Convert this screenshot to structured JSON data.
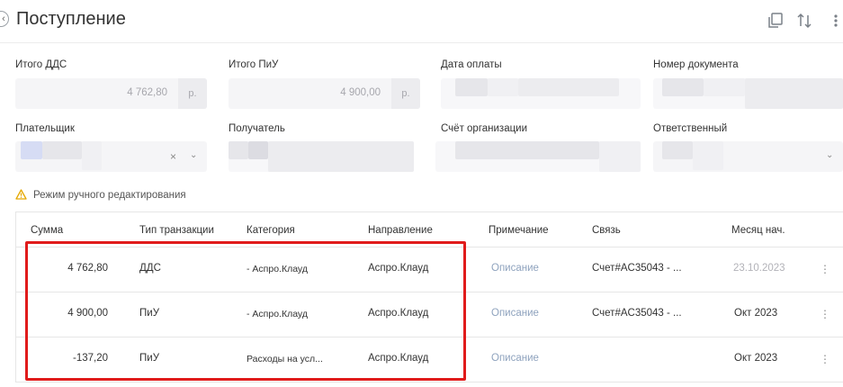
{
  "header": {
    "title": "Поступление",
    "back_icon": "chevron-left-icon",
    "copy_icon": "copy-icon",
    "sort_icon": "sort-arrows-icon",
    "more_icon": "more-vertical-icon"
  },
  "fields": {
    "total_dds": {
      "label": "Итого ДДС",
      "value": "4 762,80",
      "unit": "р."
    },
    "total_piu": {
      "label": "Итого ПиУ",
      "value": "4 900,00",
      "unit": "р."
    },
    "payment_date": {
      "label": "Дата оплаты"
    },
    "document_number": {
      "label": "Номер документа"
    },
    "payer": {
      "label": "Плательщик",
      "clear_icon": "clear-x-icon",
      "dropdown_icon": "chevron-down-icon"
    },
    "recipient": {
      "label": "Получатель"
    },
    "org_account": {
      "label": "Счёт организации"
    },
    "responsible": {
      "label": "Ответственный",
      "dropdown_icon": "chevron-down-icon"
    }
  },
  "warning": {
    "icon": "warning-triangle-icon",
    "text": "Режим ручного редактирования",
    "color": "#e5a800"
  },
  "table": {
    "columns": [
      "Сумма",
      "Тип транзакции",
      "Категория",
      "Направление",
      "Примечание",
      "Связь",
      "Месяц нач."
    ],
    "rows": [
      {
        "amount": "4 762,80",
        "type": "ДДС",
        "category": "- Аспро.Клауд",
        "direction": "Аспро.Клауд",
        "note": "Описание",
        "link": "Счет#AC35043 - ...",
        "month": "23.10.2023"
      },
      {
        "amount": "4 900,00",
        "type": "ПиУ",
        "category": "- Аспро.Клауд",
        "direction": "Аспро.Клауд",
        "note": "Описание",
        "link": "Счет#AC35043 - ...",
        "month": "Окт 2023"
      },
      {
        "amount": "-137,20",
        "type": "ПиУ",
        "category": "Расходы на усл...",
        "direction": "Аспро.Клауд",
        "note": "Описание",
        "link": "",
        "month": "Окт 2023"
      }
    ]
  },
  "colors": {
    "highlight": "#e01b1b",
    "link": "#8fa3be",
    "field_bg": "#f5f5f7"
  }
}
